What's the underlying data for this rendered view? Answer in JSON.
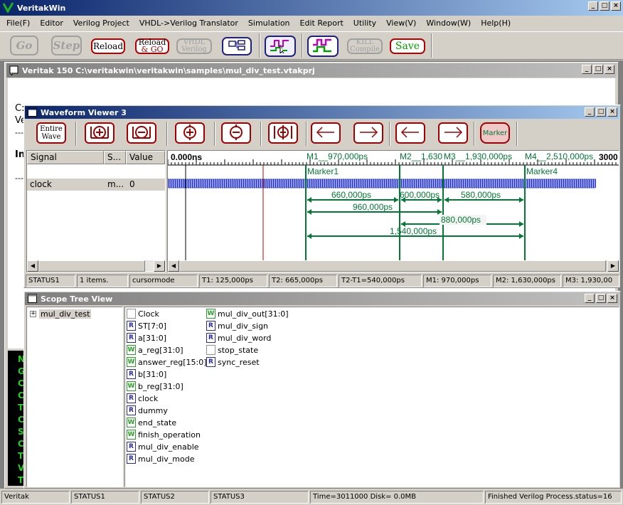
{
  "app": {
    "title": "VeritakWin",
    "menu": [
      "File(F)",
      "Editor",
      "Verilog Project",
      "VHDL->Verilog Translator",
      "Simulation",
      "Edit Report",
      "Utility",
      "View(V)",
      "Window(W)",
      "Help(H)"
    ],
    "toolbar": {
      "go": "Go",
      "step": "Step",
      "reload": "Reload",
      "reload_go_1": "Reload",
      "reload_go_2": "& GO",
      "vhdl_1": "VHDL",
      "vhdl_2": "Verilog",
      "kill_1": "KILL",
      "kill_2": "Compile",
      "save": "Save"
    },
    "status": [
      "Veritak",
      "STATUS1",
      "STATUS2",
      "STATUS3",
      "Time=3011000 Disk=  0.0MB",
      "Finished Verilog Process.status=16"
    ]
  },
  "project_window": {
    "title": "Veritak 150 C:\\veritakwin\\veritakwin\\samples\\mul_div_test.vtakprj",
    "left_fragments": [
      "C:",
      "Ve",
      "---",
      "In",
      "---"
    ],
    "console_fragments": [
      "N",
      "G",
      "C",
      "C",
      "T",
      "C",
      "S",
      "C",
      "T",
      "V",
      "T"
    ]
  },
  "waveform": {
    "title": "Waveform Viewer 3",
    "buttons": {
      "entire_1": "Entire",
      "entire_2": "Wave",
      "marker": "Marker"
    },
    "columns": {
      "signal": "Signal",
      "s": "S...",
      "value": "Value"
    },
    "signal": {
      "name": "clock",
      "s": "m...",
      "value": "0"
    },
    "time_start": "0.000ns",
    "time_end": "3000",
    "marker_headers": [
      "M1__970,000ps",
      "M2__1,630",
      "M3__1,930,000ps",
      "M4__2,510,000ps"
    ],
    "marker_names": [
      "Marker1",
      "Marker4"
    ],
    "intervals": [
      "660,000ps",
      "600,000ps",
      "580,000ps",
      "960,000ps",
      "880,000ps",
      "1,540,000ps"
    ],
    "status": [
      "STATUS1",
      "1 items.",
      "cursormode",
      "T1: 125,000ps",
      "T2: 665,000ps",
      "T2-T1=540,000ps",
      "M1: 970,000ps",
      "M2: 1,630,000ps",
      "M3: 1,930,00"
    ]
  },
  "scope": {
    "title": "Scope Tree View",
    "tree_root": "mul_div_test",
    "col1": [
      {
        "type": "",
        "name": "Clock"
      },
      {
        "type": "R",
        "name": "ST[7:0]"
      },
      {
        "type": "R",
        "name": "a[31:0]"
      },
      {
        "type": "W",
        "name": "a_reg[31:0]"
      },
      {
        "type": "W",
        "name": "answer_reg[15:0]"
      },
      {
        "type": "R",
        "name": "b[31:0]"
      },
      {
        "type": "W",
        "name": "b_reg[31:0]"
      },
      {
        "type": "R",
        "name": "clock"
      },
      {
        "type": "R",
        "name": "dummy"
      },
      {
        "type": "W",
        "name": "end_state"
      },
      {
        "type": "W",
        "name": "finish_operation"
      },
      {
        "type": "R",
        "name": "mul_div_enable"
      },
      {
        "type": "R",
        "name": "mul_div_mode"
      }
    ],
    "col2": [
      {
        "type": "W",
        "name": "mul_div_out[31:0]"
      },
      {
        "type": "R",
        "name": "mul_div_sign"
      },
      {
        "type": "R",
        "name": "mul_div_word"
      },
      {
        "type": "",
        "name": "stop_state"
      },
      {
        "type": "R",
        "name": "sync_reset"
      }
    ]
  }
}
